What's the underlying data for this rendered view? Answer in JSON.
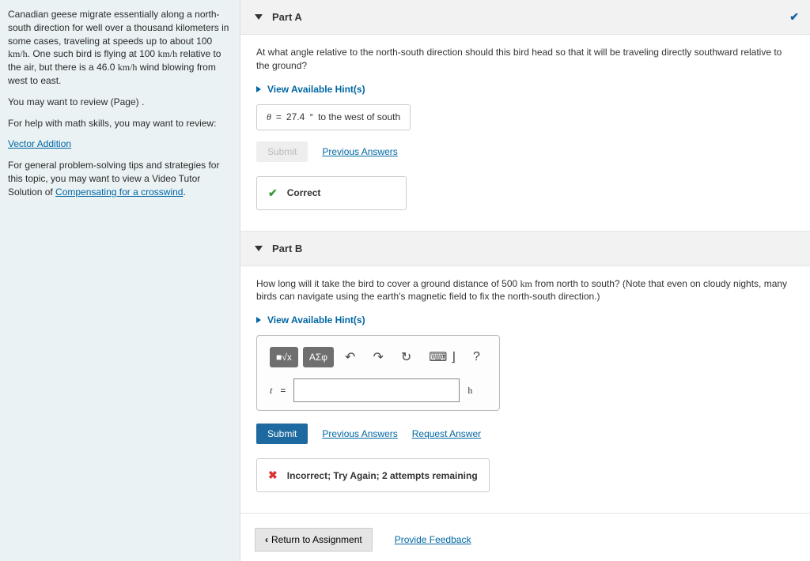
{
  "sidebar": {
    "intro_1": "Canadian geese migrate essentially along a north-south direction for well over a thousand kilometers in some cases, traveling at speeds up to about 100 ",
    "intro_unit1": "km/h",
    "intro_2": ". One such bird is flying at 100 ",
    "intro_unit2": "km/h",
    "intro_3": " relative to the air, but there is a 46.0 ",
    "intro_unit3": "km/h",
    "intro_4": " wind blowing from west to east.",
    "review_page": "You may want to review (Page) .",
    "math_help": "For help with math skills, you may want to review:",
    "vector_link": "Vector Addition",
    "tips_1": "For general problem-solving tips and strategies for this topic, you may want to view a Video Tutor Solution of ",
    "tips_link": "Compensating for a crosswind",
    "tips_2": "."
  },
  "partA": {
    "title": "Part A",
    "question": "At what angle relative to the north-south direction should this bird head so that it will be traveling directly southward relative to the ground?",
    "hints": "View Available Hint(s)",
    "theta": "θ",
    "eq": " = ",
    "value": "27.4",
    "deg": " ° ",
    "tail": "to the west of south",
    "submit": "Submit",
    "previous": "Previous Answers",
    "feedback": "Correct"
  },
  "partB": {
    "title": "Part B",
    "q1": "How long will it take the bird to cover a ground distance of 500 ",
    "q_unit": "km",
    "q2": " from north to south? (Note that even on cloudy nights, many birds can navigate using the earth's magnetic field to fix the north-south direction.)",
    "hints": "View Available Hint(s)",
    "var": "t",
    "eq": " = ",
    "unit": "h",
    "submit": "Submit",
    "previous": "Previous Answers",
    "request": "Request Answer",
    "feedback": "Incorrect; Try Again; 2 attempts remaining",
    "toolbar": {
      "templates": "■√x",
      "symbols": "ΑΣφ",
      "undo": "↶",
      "redo": "↷",
      "reset": "↻",
      "keyboard": "⌨ ⌋",
      "help": "?"
    }
  },
  "footer": {
    "return": "Return to Assignment",
    "feedback": "Provide Feedback"
  }
}
